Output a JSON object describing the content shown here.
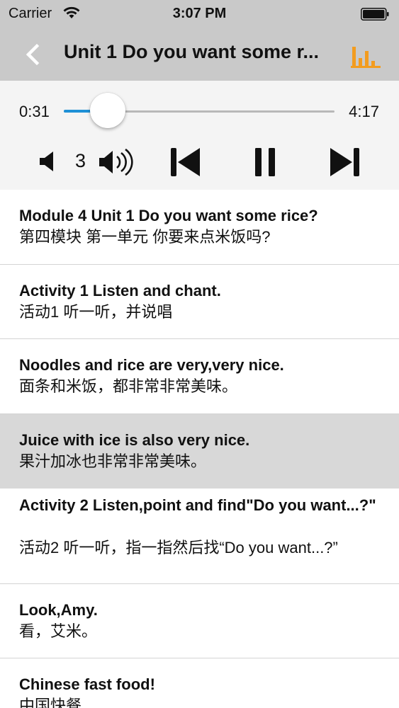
{
  "status_bar": {
    "carrier": "Carrier",
    "time": "3:07 PM"
  },
  "nav": {
    "title": "Unit 1 Do you want some r...",
    "back_icon": "chevron-left-icon",
    "right_icon": "equalizer-icon",
    "accent_color": "#f39c1f"
  },
  "player": {
    "current_time": "0:31",
    "total_time": "4:17",
    "progress": 0.1206,
    "volume_level": "3",
    "progress_color": "#1e90d6"
  },
  "items": [
    {
      "en": "Module 4 Unit 1 Do you want some rice?",
      "zh": "第四模块 第一单元 你要来点米饭吗?",
      "active": false
    },
    {
      "en": "Activity 1 Listen and chant.",
      "zh": "活动1 听一听，并说唱",
      "active": false
    },
    {
      "en": "Noodles and rice are very,very nice.",
      "zh": "面条和米饭，都非常非常美味。",
      "active": false
    },
    {
      "en": "Juice with ice is also very nice.",
      "zh": "果汁加冰也非常非常美味。",
      "active": true
    },
    {
      "en": "Activity 2 Listen,point and find\"Do you want...?\"",
      "zh": "活动2 听一听，指一指然后找“Do you want...?”",
      "active": false
    },
    {
      "en": "Look,Amy.",
      "zh": "看，艾米。",
      "active": false
    },
    {
      "en": "Chinese fast food!",
      "zh": "中国快餐",
      "active": false
    }
  ]
}
